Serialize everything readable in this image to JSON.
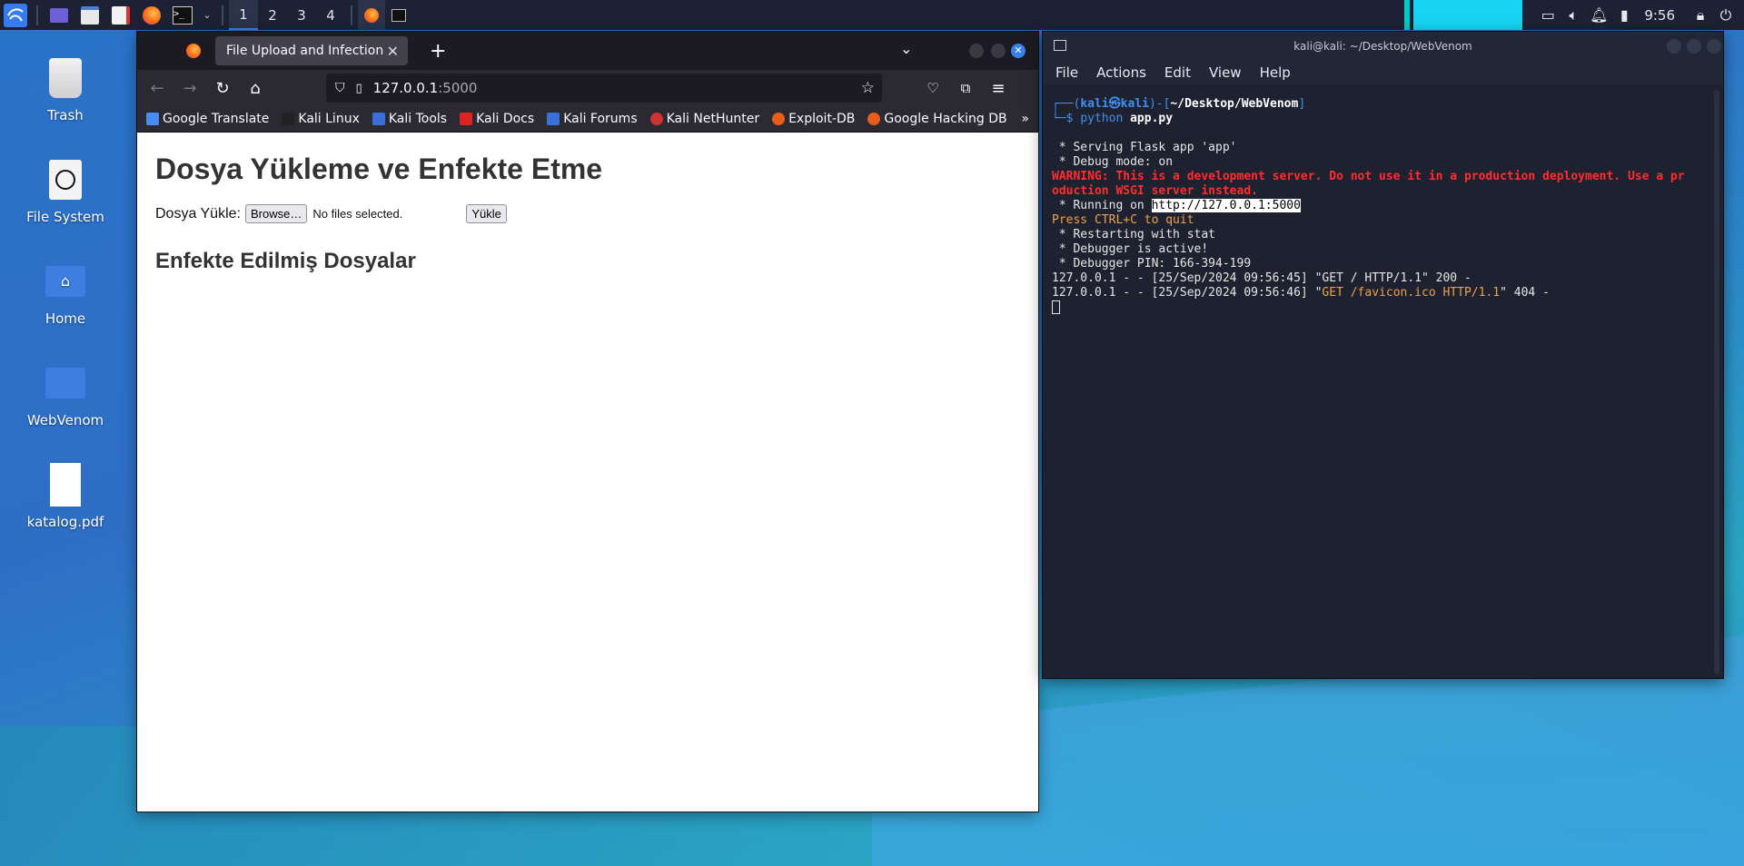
{
  "taskbar": {
    "workspaces": [
      "1",
      "2",
      "3",
      "4"
    ],
    "clock": "9:56"
  },
  "desktop": {
    "icons": [
      {
        "label": "Trash"
      },
      {
        "label": "File System"
      },
      {
        "label": "Home"
      },
      {
        "label": "WebVenom"
      },
      {
        "label": "katalog.pdf"
      }
    ]
  },
  "browser": {
    "tab_title": "File Upload and Infection",
    "url_host": "127.0.0.1",
    "url_port": ":5000",
    "bookmarks": [
      "Google Translate",
      "Kali Linux",
      "Kali Tools",
      "Kali Docs",
      "Kali Forums",
      "Kali NetHunter",
      "Exploit-DB",
      "Google Hacking DB"
    ],
    "page": {
      "heading": "Dosya Yükleme ve Enfekte Etme",
      "upload_label": "Dosya Yükle:",
      "browse_button": "Browse…",
      "no_file_text": "No files selected.",
      "upload_button": "Yükle",
      "infected_heading": "Enfekte Edilmiş Dosyalar"
    }
  },
  "terminal": {
    "title": "kali@kali: ~/Desktop/WebVenom",
    "menu": [
      "File",
      "Actions",
      "Edit",
      "View",
      "Help"
    ],
    "prompt": {
      "prefix": "┌──(",
      "user": "kali㉿kali",
      "mid": ")-[",
      "path": "~/Desktop/WebVenom",
      "suffix": "]",
      "line2": "└─$ ",
      "cmd": "python",
      "arg": "app.py"
    },
    "lines": {
      "l1": " * Serving Flask app 'app'",
      "l2": " * Debug mode: on",
      "warn1": "WARNING: This is a development server. Do not use it in a production deployment. Use a pr",
      "warn2": "oduction WSGI server instead.",
      "running_pre": " * Running on ",
      "running_url": "http://127.0.0.1:5000",
      "ctrlc": "Press CTRL+C to quit",
      "l5": " * Restarting with stat",
      "l6": " * Debugger is active!",
      "l7": " * Debugger PIN: 166-394-199",
      "log1": "127.0.0.1 - - [25/Sep/2024 09:56:45] \"GET / HTTP/1.1\" 200 -",
      "log2_pre": "127.0.0.1 - - [25/Sep/2024 09:56:46] \"",
      "log2_req": "GET /favicon.ico HTTP/1.1",
      "log2_post": "\" 404 -"
    }
  },
  "colors": {
    "terminal_bg": "#1e2230",
    "warning": "#ff2d2d",
    "accent_blue": "#3f8ff0",
    "taskbar_bg": "#1c2233"
  }
}
